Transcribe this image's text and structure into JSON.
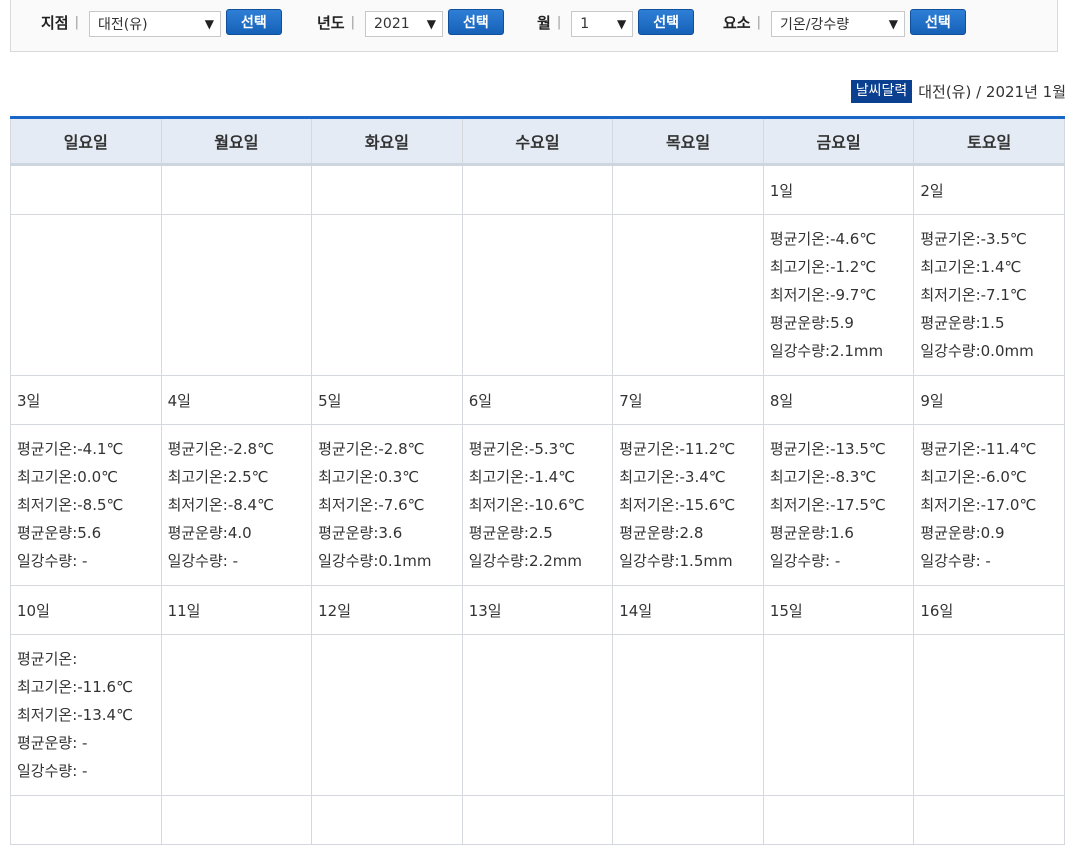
{
  "filters": [
    {
      "label": "지점",
      "value": "대전(유)",
      "button": "선택"
    },
    {
      "label": "년도",
      "value": "2021",
      "button": "선택"
    },
    {
      "label": "월",
      "value": "1",
      "button": "선택"
    },
    {
      "label": "요소",
      "value": "기온/강수량",
      "button": "선택"
    }
  ],
  "separator": "|",
  "caption": {
    "badge": "날씨달력",
    "text": "대전(유) / 2021년 1월"
  },
  "weekdays": [
    "일요일",
    "월요일",
    "화요일",
    "수요일",
    "목요일",
    "금요일",
    "토요일"
  ],
  "weeks": [
    {
      "dates": [
        "",
        "",
        "",
        "",
        "",
        "1일",
        "2일"
      ],
      "cells": [
        [],
        [],
        [],
        [],
        [],
        [
          "평균기온:-4.6℃",
          "최고기온:-1.2℃",
          "최저기온:-9.7℃",
          "평균운량:5.9",
          "일강수량:2.1mm"
        ],
        [
          "평균기온:-3.5℃",
          "최고기온:1.4℃",
          "최저기온:-7.1℃",
          "평균운량:1.5",
          "일강수량:0.0mm"
        ]
      ]
    },
    {
      "dates": [
        "3일",
        "4일",
        "5일",
        "6일",
        "7일",
        "8일",
        "9일"
      ],
      "cells": [
        [
          "평균기온:-4.1℃",
          "최고기온:0.0℃",
          "최저기온:-8.5℃",
          "평균운량:5.6",
          "일강수량: -"
        ],
        [
          "평균기온:-2.8℃",
          "최고기온:2.5℃",
          "최저기온:-8.4℃",
          "평균운량:4.0",
          "일강수량: -"
        ],
        [
          "평균기온:-2.8℃",
          "최고기온:0.3℃",
          "최저기온:-7.6℃",
          "평균운량:3.6",
          "일강수량:0.1mm"
        ],
        [
          "평균기온:-5.3℃",
          "최고기온:-1.4℃",
          "최저기온:-10.6℃",
          "평균운량:2.5",
          "일강수량:2.2mm"
        ],
        [
          "평균기온:-11.2℃",
          "최고기온:-3.4℃",
          "최저기온:-15.6℃",
          "평균운량:2.8",
          "일강수량:1.5mm"
        ],
        [
          "평균기온:-13.5℃",
          "최고기온:-8.3℃",
          "최저기온:-17.5℃",
          "평균운량:1.6",
          "일강수량: -"
        ],
        [
          "평균기온:-11.4℃",
          "최고기온:-6.0℃",
          "최저기온:-17.0℃",
          "평균운량:0.9",
          "일강수량: -"
        ]
      ]
    },
    {
      "dates": [
        "10일",
        "11일",
        "12일",
        "13일",
        "14일",
        "15일",
        "16일"
      ],
      "cells": [
        [
          "평균기온:",
          "최고기온:-11.6℃",
          "최저기온:-13.4℃",
          "평균운량: -",
          "일강수량: -"
        ],
        [],
        [],
        [],
        [],
        [],
        []
      ]
    }
  ]
}
